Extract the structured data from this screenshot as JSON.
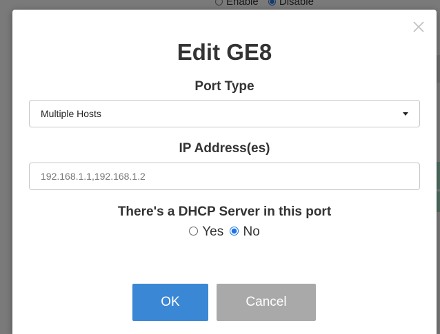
{
  "background": {
    "radio_options": [
      {
        "label": "Enable",
        "checked": false
      },
      {
        "label": "Disable",
        "checked": true
      }
    ]
  },
  "modal": {
    "title": "Edit GE8",
    "close_icon": "close-icon",
    "port_type": {
      "label": "Port Type",
      "selected": "Multiple Hosts"
    },
    "ip_addresses": {
      "label": "IP Address(es)",
      "value": "192.168.1.1,192.168.1.2"
    },
    "dhcp": {
      "label": "There's a DHCP Server in this port",
      "options": [
        {
          "label": "Yes",
          "checked": false
        },
        {
          "label": "No",
          "checked": true
        }
      ]
    },
    "buttons": {
      "ok": "OK",
      "cancel": "Cancel"
    }
  },
  "colors": {
    "primary_button": "#3a87d6",
    "secondary_button": "#a9a9a9",
    "radio_checked": "#1a73e8",
    "overlay": "rgba(0,0,0,0.5)"
  }
}
